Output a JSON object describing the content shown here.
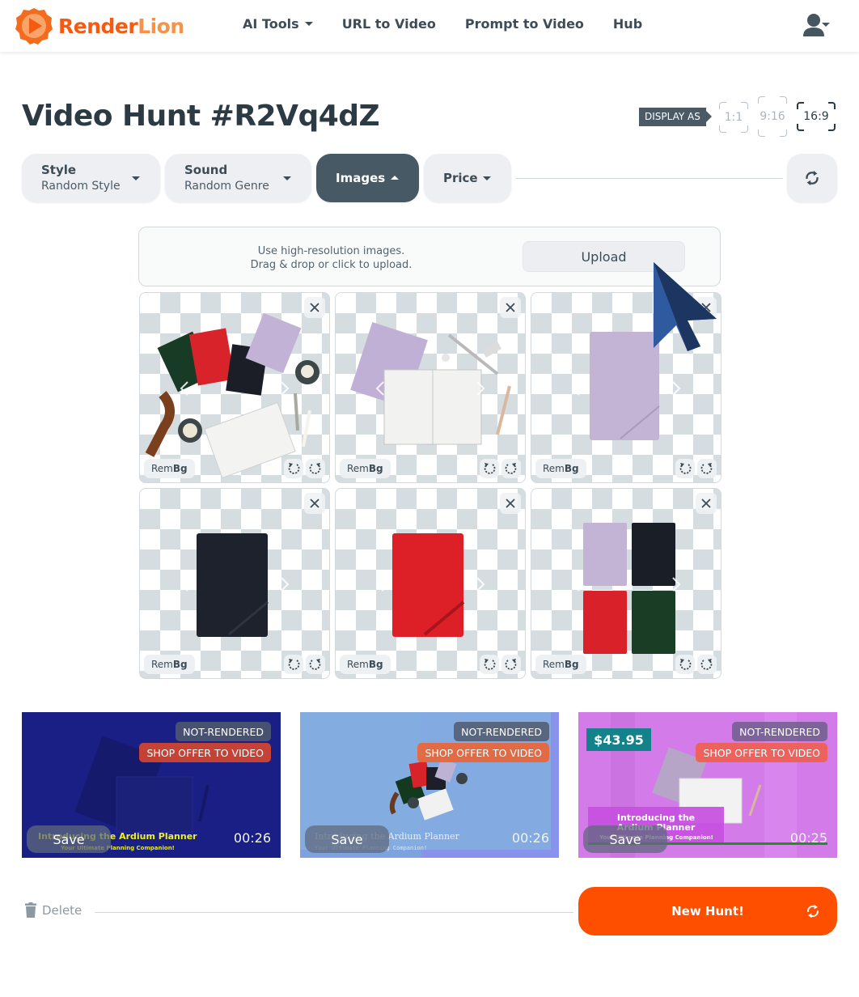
{
  "brand": {
    "name_part1": "Render",
    "name_part2": "Lion",
    "accent": "#fe4f00"
  },
  "nav": {
    "items": [
      {
        "label": "AI Tools",
        "has_dropdown": true
      },
      {
        "label": "URL to Video",
        "has_dropdown": false
      },
      {
        "label": "Prompt to Video",
        "has_dropdown": false
      },
      {
        "label": "Hub",
        "has_dropdown": false
      }
    ],
    "user_icon": "user-icon"
  },
  "page": {
    "title": "Video Hunt #R2Vq4dZ",
    "display_as_label": "DISPLAY AS",
    "ratios": [
      {
        "label": "1:1",
        "active": false
      },
      {
        "label": "9:16",
        "active": false
      },
      {
        "label": "16:9",
        "active": true
      }
    ]
  },
  "filters": [
    {
      "label": "Style",
      "value": "Random Style"
    },
    {
      "label": "Sound",
      "value": "Random Genre"
    },
    {
      "label": "Images",
      "value": "",
      "expanded": true
    },
    {
      "label": "Price",
      "value": ""
    }
  ],
  "upload": {
    "hint_line1": "Use high-resolution images.",
    "hint_line2": "Drag & drop or click to upload.",
    "button_label": "Upload"
  },
  "image_tiles": [
    {
      "subject": "flat-lay planners with accessories",
      "rembg_prefix": "Rem",
      "rembg_bold": "Bg"
    },
    {
      "subject": "open planner with lilac cover and pens",
      "rembg_prefix": "Rem",
      "rembg_bold": "Bg"
    },
    {
      "subject": "lilac planner",
      "rembg_prefix": "Rem",
      "rembg_bold": "Bg"
    },
    {
      "subject": "black planner",
      "rembg_prefix": "Rem",
      "rembg_bold": "Bg"
    },
    {
      "subject": "red planner",
      "rembg_prefix": "Rem",
      "rembg_bold": "Bg"
    },
    {
      "subject": "four planners grid",
      "rembg_prefix": "Rem",
      "rembg_bold": "Bg"
    }
  ],
  "videos": [
    {
      "status": "NOT-RENDERED",
      "action": "SHOP OFFER TO VIDEO",
      "save_label": "Save",
      "duration": "00:26",
      "title": "Introducing the Ardium Planner",
      "subtitle": "Your Ultimate Planning Companion!",
      "price": ""
    },
    {
      "status": "NOT-RENDERED",
      "action": "SHOP OFFER TO VIDEO",
      "save_label": "Save",
      "duration": "00:26",
      "title": "Introducing the Ardium Planner",
      "subtitle": "Your Ultimate Planning Companion!",
      "price": ""
    },
    {
      "status": "NOT-RENDERED",
      "action": "SHOP OFFER TO VIDEO",
      "save_label": "Save",
      "duration": "00:25",
      "title": "Introducing the Ardium Planner",
      "subtitle": "Your Ultimate Planning Companion!",
      "price": "$43.95"
    }
  ],
  "footer": {
    "delete_label": "Delete",
    "new_hunt_label": "New Hunt!"
  }
}
